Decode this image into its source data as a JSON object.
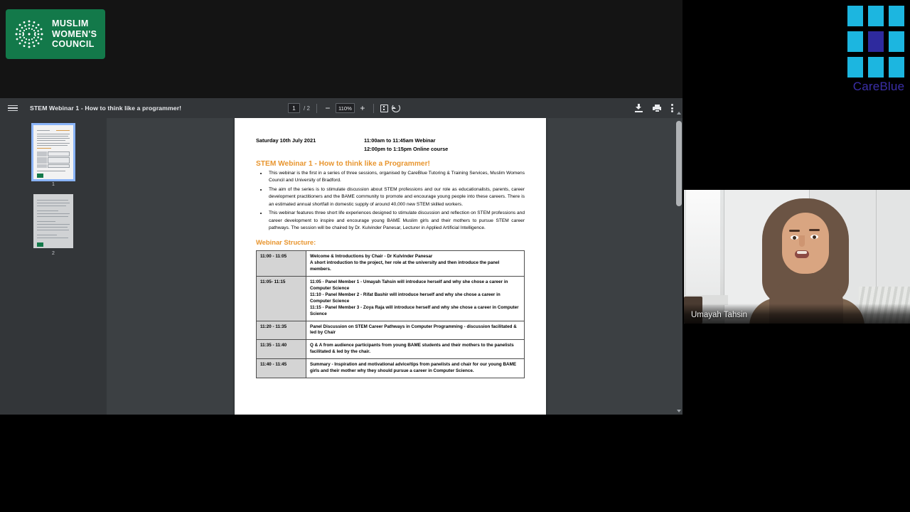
{
  "meeting": {
    "organization_logo_text": "MUSLIM\nWOMEN'S\nCOUNCIL",
    "org_line1": "MUSLIM",
    "org_line2": "WOMEN'S",
    "org_line3": "COUNCIL",
    "org_logo_color": "#13794a"
  },
  "sponsor": {
    "name": "CareBlue",
    "tile_color": "#1cb6e0",
    "center_tile_color": "#2e2a9e",
    "text_color": "#3b2fa8"
  },
  "video": {
    "participant_name": "Umayah Tahsin"
  },
  "pdf_toolbar": {
    "menu_icon": "hamburger-menu-icon",
    "document_title": "STEM Webinar 1 - How to think like a programmer!",
    "current_page": "1",
    "page_separator": "/",
    "total_pages": "2",
    "zoom_out_label": "−",
    "zoom_level": "110%",
    "zoom_in_label": "+",
    "fit_icon": "fit-to-page-icon",
    "rotate_icon": "rotate-icon",
    "download_icon": "download-icon",
    "print_icon": "print-icon",
    "more_icon": "more-options-icon"
  },
  "thumbnails": [
    {
      "number": "1",
      "selected": true
    },
    {
      "number": "2",
      "selected": false
    }
  ],
  "document": {
    "date": "Saturday 10th July 2021",
    "time_line1": "11:00am to 11:45am Webinar",
    "time_line2": "12:00pm to 1:15pm Online course",
    "heading": "STEM Webinar 1 - How to think like a Programmer!",
    "bullets": [
      "This webinar is the first in a series of three sessions, organised by CareBlue Tutoring & Training Services, Muslim Womens Council and University of Bradford.",
      "The aim of the series is to stimulate discussion about STEM professions and our role as educationalists, parents, career development practitioners and the BAME community to promote and encourage young people into these careers. There is an estimated annual shortfall in domestic supply of around 40,000 new STEM skilled workers.",
      "This webinar features three short life experiences designed to stimulate discussion and reflection on STEM professions and career development to inspire and encourage young BAME Muslim girls and their mothers to pursue STEM career pathways. The session will be chaired by Dr. Kulvinder Panesar, Lecturer in Applied Artificial Intelligence."
    ],
    "structure_heading": "Webinar Structure:",
    "schedule": [
      {
        "time": "11:00 - 11:05",
        "lines": [
          "Welcome & Introductions by Chair - Dr Kulvinder Panesar",
          "A short introduction to the project, her role at the university and then introduce the panel members."
        ]
      },
      {
        "time": "11:05- 11:15",
        "lines": [
          "11:05 - Panel Member 1 - Umayah Tahsin will introduce herself and why she chose a career in Computer Science",
          "11:10 - Panel Member 2 - Rifat Bashir will introduce herself and why she chose a career in Computer Science",
          "11:15 - Panel Member 3 - Zoya Raja will introduce herself and why she chose a career in Computer Science"
        ]
      },
      {
        "time": "11:20 - 11:35",
        "lines": [
          "Panel Discussion on STEM Career Pathways in Computer Programming - discussion facilitated & led by Chair"
        ]
      },
      {
        "time": "11:35 - 11:40",
        "lines": [
          "Q & A from audience participants from young BAME students and their mothers to the panelists facilitated & led by the chair."
        ]
      },
      {
        "time": "11:40 - 11:45",
        "lines": [
          "Summary - Inspiration and motivational advice/tips from panelists and chair for our young BAME girls and their mother why they should pursue a career in Computer Science."
        ]
      }
    ],
    "heading_color": "#e8952e"
  }
}
